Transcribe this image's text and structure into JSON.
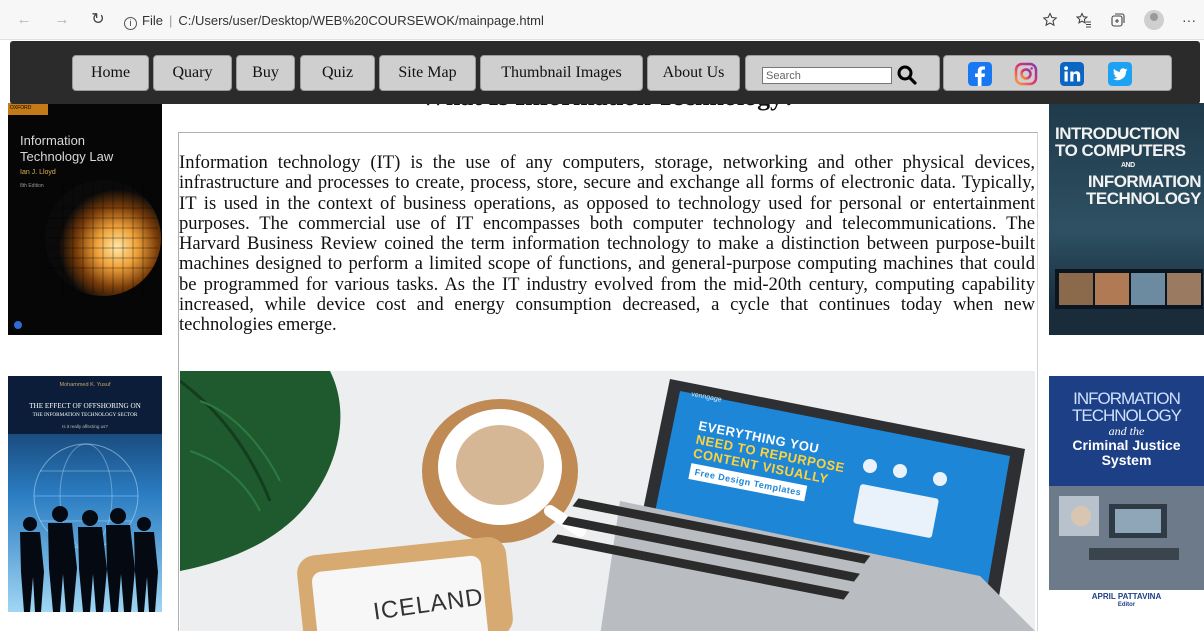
{
  "browser": {
    "back_icon": "back-arrow-icon",
    "forward_icon": "forward-arrow-icon",
    "reload_icon": "reload-icon",
    "info_label": "i",
    "scheme_label": "File",
    "url": "C:/Users/user/Desktop/WEB%20COURSEWOK/mainpage.html"
  },
  "nav": {
    "items": [
      {
        "label": "Home"
      },
      {
        "label": "Quary"
      },
      {
        "label": "Buy"
      },
      {
        "label": "Quiz"
      },
      {
        "label": "Site Map"
      },
      {
        "label": "Thumbnail Images"
      },
      {
        "label": "About Us"
      }
    ],
    "search_placeholder": "Search",
    "social": [
      "facebook-icon",
      "instagram-icon",
      "linkedin-icon",
      "twitter-icon"
    ]
  },
  "main": {
    "title": "What Is Information Technology?",
    "body": "Information technology (IT) is the use of any computers, storage, networking and other physical devices, infrastructure and processes to create, process, store, secure and exchange all forms of electronic data. Typically, IT is used in the context of business operations, as opposed to technology used for personal or entertainment purposes. The commercial use of IT encompasses both computer technology and telecommunications. The Harvard Business Review coined the term information technology to make a distinction between purpose-built machines designed to perform a limited scope of functions, and general-purpose computing machines that could be programmed for various tasks. As the IT industry evolved from the mid-20th century, computing capability increased, while device cost and energy consumption decreased, a cycle that continues today when new technologies emerge."
  },
  "hero": {
    "screen_line1": "EVERYTHING YOU",
    "screen_line2": "NEED TO REPURPOSE",
    "screen_line3": "CONTENT VISUALLY",
    "screen_badge": "Free Design Templates",
    "screen_brand": "venngage",
    "tablet_text": "ICELAND"
  },
  "books": {
    "left_top": {
      "publisher": "OXFORD",
      "title_line1": "Information",
      "title_line2": "Technology Law",
      "author": "Ian J. Lloyd",
      "edition": "8th Edition"
    },
    "left_bottom": {
      "author": "Mohammed K. Yusuf",
      "title_line1": "THE EFFECT OF OFFSHORING ON",
      "title_line2": "THE INFORMATION TECHNOLOGY SECTOR",
      "subtitle": "Is it really affecting us?"
    },
    "right_top": {
      "line1": "INTRODUCTION",
      "line2": "TO COMPUTERS",
      "line3": "AND",
      "line4": "INFORMATION",
      "line5": "TECHNOLOGY"
    },
    "right_bottom": {
      "line1": "INFORMATION",
      "line2": "TECHNOLOGY",
      "line3": "and the",
      "line4": "Criminal Justice",
      "line5": "System",
      "author": "APRIL PATTAVINA",
      "role": "Editor"
    }
  }
}
